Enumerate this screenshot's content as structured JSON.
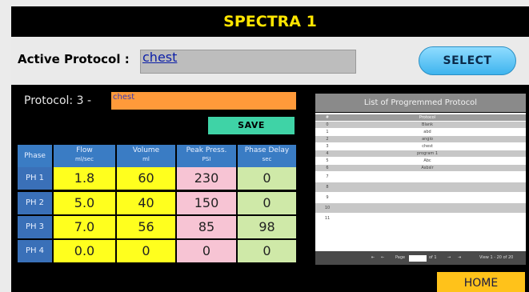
{
  "header": {
    "title": "SPECTRA 1"
  },
  "active": {
    "label": "Active Protocol :",
    "value": "chest",
    "select_label": "SELECT"
  },
  "protocol": {
    "label": "Protocol:  3 -",
    "name": "chest",
    "save_label": "SAVE"
  },
  "phase_table": {
    "headers": [
      {
        "line1": "Phase",
        "line2": ""
      },
      {
        "line1": "Flow",
        "line2": "ml/sec"
      },
      {
        "line1": "Volume",
        "line2": "ml"
      },
      {
        "line1": "Peak Press.",
        "line2": "PSI"
      },
      {
        "line1": "Phase Delay",
        "line2": "sec"
      }
    ],
    "rows": [
      {
        "phase": "PH 1",
        "flow": "1.8",
        "volume": "60",
        "pressure": "230",
        "delay": "0"
      },
      {
        "phase": "PH 2",
        "flow": "5.0",
        "volume": "40",
        "pressure": "150",
        "delay": "0"
      },
      {
        "phase": "PH 3",
        "flow": "7.0",
        "volume": "56",
        "pressure": "85",
        "delay": "98"
      },
      {
        "phase": "PH 4",
        "flow": "0.0",
        "volume": "0",
        "pressure": "0",
        "delay": "0"
      }
    ]
  },
  "program_list": {
    "title": "List of Progremmed Protocol",
    "col_num": "#",
    "col_name": "Protocol",
    "rows": [
      {
        "num": "0",
        "name": "Blank"
      },
      {
        "num": "1",
        "name": "abd"
      },
      {
        "num": "2",
        "name": "angio"
      },
      {
        "num": "3",
        "name": "chest"
      },
      {
        "num": "4",
        "name": "program 1"
      },
      {
        "num": "5",
        "name": "Abc"
      },
      {
        "num": "6",
        "name": "Asbslr"
      },
      {
        "num": "7",
        "name": ""
      },
      {
        "num": "8",
        "name": ""
      },
      {
        "num": "9",
        "name": ""
      },
      {
        "num": "10",
        "name": ""
      },
      {
        "num": "11",
        "name": ""
      }
    ],
    "footer": {
      "page_label": "Page",
      "of_label": "of 1",
      "view_label": "View 1 - 20 of 20"
    }
  },
  "footer": {
    "home_label": "HOME"
  },
  "colors": {
    "title": "#ffe500",
    "select": "#3fb4ee",
    "protocol_name_bg": "#ff9a3a",
    "save": "#3fd3a6",
    "header_blue": "#3a7cc4",
    "flow_volume": "#ffff1e",
    "pressure": "#f7c4d4",
    "delay": "#cfe9a8",
    "home": "#ffc21a"
  }
}
